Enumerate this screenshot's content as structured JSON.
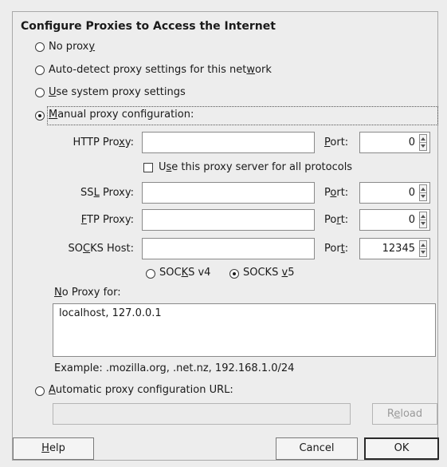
{
  "title": "Configure Proxies to Access the Internet",
  "modes": {
    "no_proxy": {
      "pre": "No prox",
      "key": "y",
      "post": ""
    },
    "auto_detect": {
      "pre": "Auto-detect proxy settings for this net",
      "key": "w",
      "post": "ork"
    },
    "system": {
      "pre": "",
      "key": "U",
      "post": "se system proxy settings"
    },
    "manual": {
      "pre": "",
      "key": "M",
      "post": "anual proxy configuration:"
    },
    "auto_url": {
      "pre": "",
      "key": "A",
      "post": "utomatic proxy configuration URL:"
    },
    "selected": "manual"
  },
  "manual": {
    "http": {
      "label_pre": "HTTP Pro",
      "label_key": "x",
      "label_post": "y:",
      "value": "",
      "port_pre": "",
      "port_key": "P",
      "port_post": "ort:",
      "port_value": "0"
    },
    "share_all": {
      "pre": "U",
      "key": "s",
      "post": "e this proxy server for all protocols",
      "checked": false
    },
    "ssl": {
      "label_pre": "SS",
      "label_key": "L",
      "label_post": " Proxy:",
      "value": "",
      "port_pre": "P",
      "port_key": "o",
      "port_post": "rt:",
      "port_value": "0"
    },
    "ftp": {
      "label_pre": "",
      "label_key": "F",
      "label_post": "TP Proxy:",
      "value": "",
      "port_pre": "Po",
      "port_key": "r",
      "port_post": "t:",
      "port_value": "0"
    },
    "socks": {
      "label_pre": "SO",
      "label_key": "C",
      "label_post": "KS Host:",
      "value": "",
      "port_pre": "Por",
      "port_key": "t",
      "port_post": ":",
      "port_value": "12345"
    },
    "socks_v4": {
      "pre": "SOC",
      "key": "K",
      "post": "S v4"
    },
    "socks_v5": {
      "pre": "SOCKS ",
      "key": "v",
      "post": "5"
    },
    "socks_version": "v5",
    "no_proxy_label": {
      "pre": "",
      "key": "N",
      "post": "o Proxy for:"
    },
    "no_proxy_value": "localhost, 127.0.0.1",
    "example": "Example: .mozilla.org, .net.nz, 192.168.1.0/24"
  },
  "auto_url_value": "",
  "reload": {
    "pre": "R",
    "key": "e",
    "post": "load"
  },
  "buttons": {
    "help": {
      "pre": "",
      "key": "H",
      "post": "elp"
    },
    "cancel": "Cancel",
    "ok": "OK"
  }
}
